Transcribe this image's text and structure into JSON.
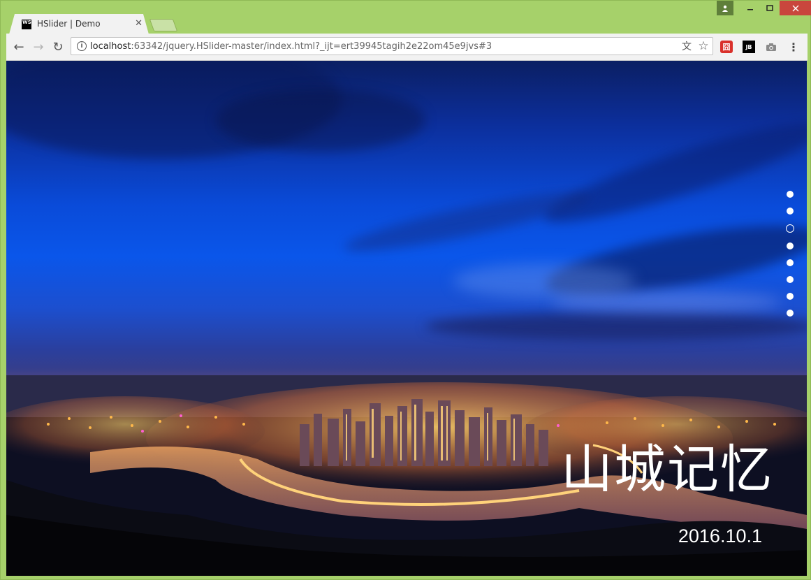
{
  "browser": {
    "tab_title": "HSlider | Demo",
    "tab_favicon_text": "WS",
    "url_host": "localhost",
    "url_rest": ":63342/jquery.HSlider-master/index.html?_ijt=ert39945tagih2e22om45e9jvs#3",
    "extensions": [
      {
        "name": "red-extension-icon",
        "glyph": "囧"
      },
      {
        "name": "jetbrains-icon",
        "glyph": "JB"
      },
      {
        "name": "camera-icon",
        "glyph": "📷"
      },
      {
        "name": "menu-icon",
        "glyph": "⋮"
      }
    ],
    "icons": {
      "back": "←",
      "forward": "→",
      "reload": "↻",
      "info": "i",
      "translate": "文",
      "star": "☆",
      "close": "✕",
      "minimize": "—",
      "maximize": "☐",
      "window_close": "✕",
      "profile": "👤"
    },
    "theme_color": "#a6d16a"
  },
  "slider": {
    "title": "山城记忆",
    "date": "2016.10.1",
    "dot_count": 8,
    "active_index": 2
  }
}
